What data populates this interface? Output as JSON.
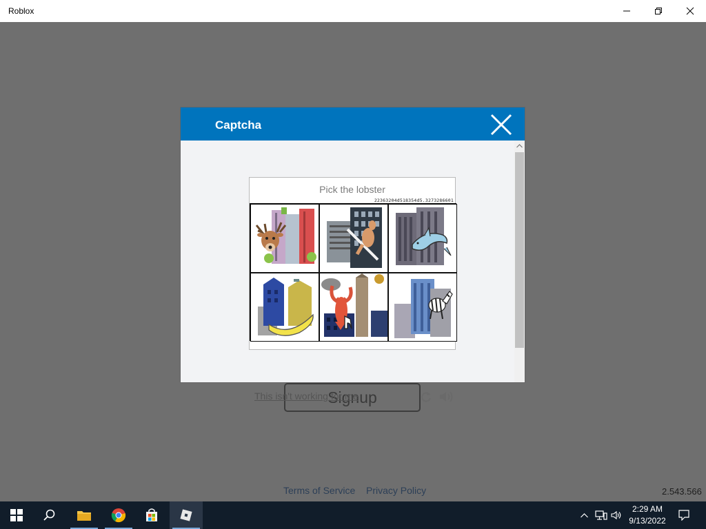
{
  "window": {
    "title": "Roblox",
    "minimize_icon": "minimize-icon",
    "maximize_icon": "restore-icon",
    "close_icon": "close-icon"
  },
  "app": {
    "signup_label": "Signup",
    "footer": {
      "terms": "Terms of Service",
      "privacy": "Privacy Policy"
    },
    "version": "2.543.566"
  },
  "dialog": {
    "title": "Captcha",
    "accent_color": "#0074bd",
    "captcha": {
      "instruction": "Pick the lobster",
      "id_text": "22363204d518354d5.3273286601",
      "tiles": [
        {
          "name": "deer-tile",
          "subject": "deer"
        },
        {
          "name": "kangaroo-tile",
          "subject": "kangaroo"
        },
        {
          "name": "dolphin-tile",
          "subject": "dolphin"
        },
        {
          "name": "banana-tile",
          "subject": "banana"
        },
        {
          "name": "lobster-tile",
          "subject": "lobster"
        },
        {
          "name": "zebra-tile",
          "subject": "zebra"
        }
      ],
      "not_working_label": "This isn't working for me",
      "refresh_icon": "refresh-icon",
      "audio_icon": "audio-icon"
    }
  },
  "taskbar": {
    "items": [
      "windows-start",
      "search",
      "file-explorer",
      "chrome",
      "microsoft-store",
      "roblox"
    ],
    "active": "roblox",
    "time": "2:29 AM",
    "date": "9/13/2022"
  }
}
